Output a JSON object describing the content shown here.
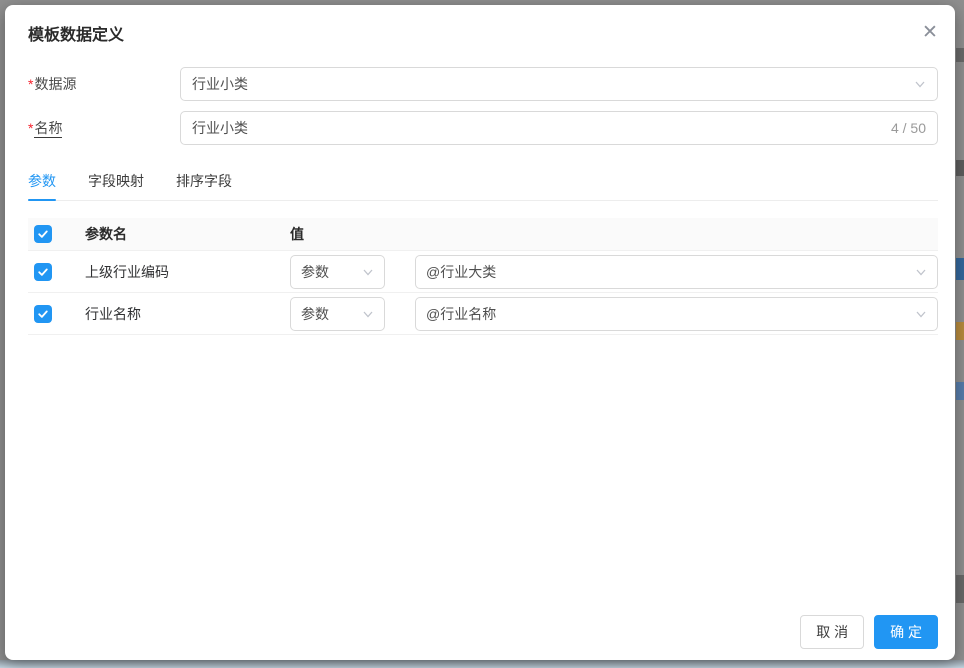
{
  "modal": {
    "title": "模板数据定义",
    "close_glyph": "✕"
  },
  "form": {
    "required_mark": "*",
    "datasource_label": "数据源",
    "datasource_value": "行业小类",
    "name_label": "名称",
    "name_value": "行业小类",
    "name_counter": "4 / 50"
  },
  "tabs": [
    {
      "label": "参数",
      "active": true
    },
    {
      "label": "字段映射",
      "active": false
    },
    {
      "label": "排序字段",
      "active": false
    }
  ],
  "table": {
    "col_param": "参数名",
    "col_value": "值",
    "rows": [
      {
        "checked": true,
        "param": "上级行业编码",
        "type_select": "参数",
        "value_select": "@行业大类"
      },
      {
        "checked": true,
        "param": "行业名称",
        "type_select": "参数",
        "value_select": "@行业名称"
      }
    ]
  },
  "footer": {
    "cancel_label": "取 消",
    "confirm_label": "确 定"
  },
  "colors": {
    "accent": "#2196f3",
    "danger": "#f5222d",
    "border": "#d9d9d9"
  }
}
